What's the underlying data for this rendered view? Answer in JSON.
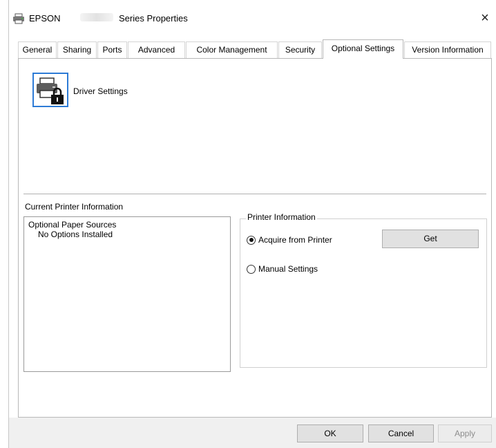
{
  "window": {
    "brand": "EPSON",
    "title": "Series Properties",
    "close_glyph": "×"
  },
  "tabs": [
    {
      "label": "General"
    },
    {
      "label": "Sharing"
    },
    {
      "label": "Ports"
    },
    {
      "label": "Advanced"
    },
    {
      "label": "Color Management"
    },
    {
      "label": "Security"
    },
    {
      "label": "Optional Settings"
    },
    {
      "label": "Version Information"
    }
  ],
  "active_tab": "Optional Settings",
  "driver": {
    "label": "Driver Settings",
    "icon": "printer-lock-icon"
  },
  "current_printer_info": {
    "heading": "Current Printer Information",
    "list_items": [
      "Optional Paper Sources",
      "No Options Installed"
    ]
  },
  "printer_info": {
    "group_title": "Printer Information",
    "option_acquire": "Acquire from Printer",
    "option_manual": "Manual Settings",
    "selected": "acquire",
    "get_label": "Get"
  },
  "footer": {
    "ok_label": "OK",
    "cancel_label": "Cancel",
    "apply_label": "Apply"
  },
  "colors": {
    "accent": "#2d7bd6",
    "button_face": "#e1e1e1",
    "footer_bg": "#f0f0f0"
  }
}
